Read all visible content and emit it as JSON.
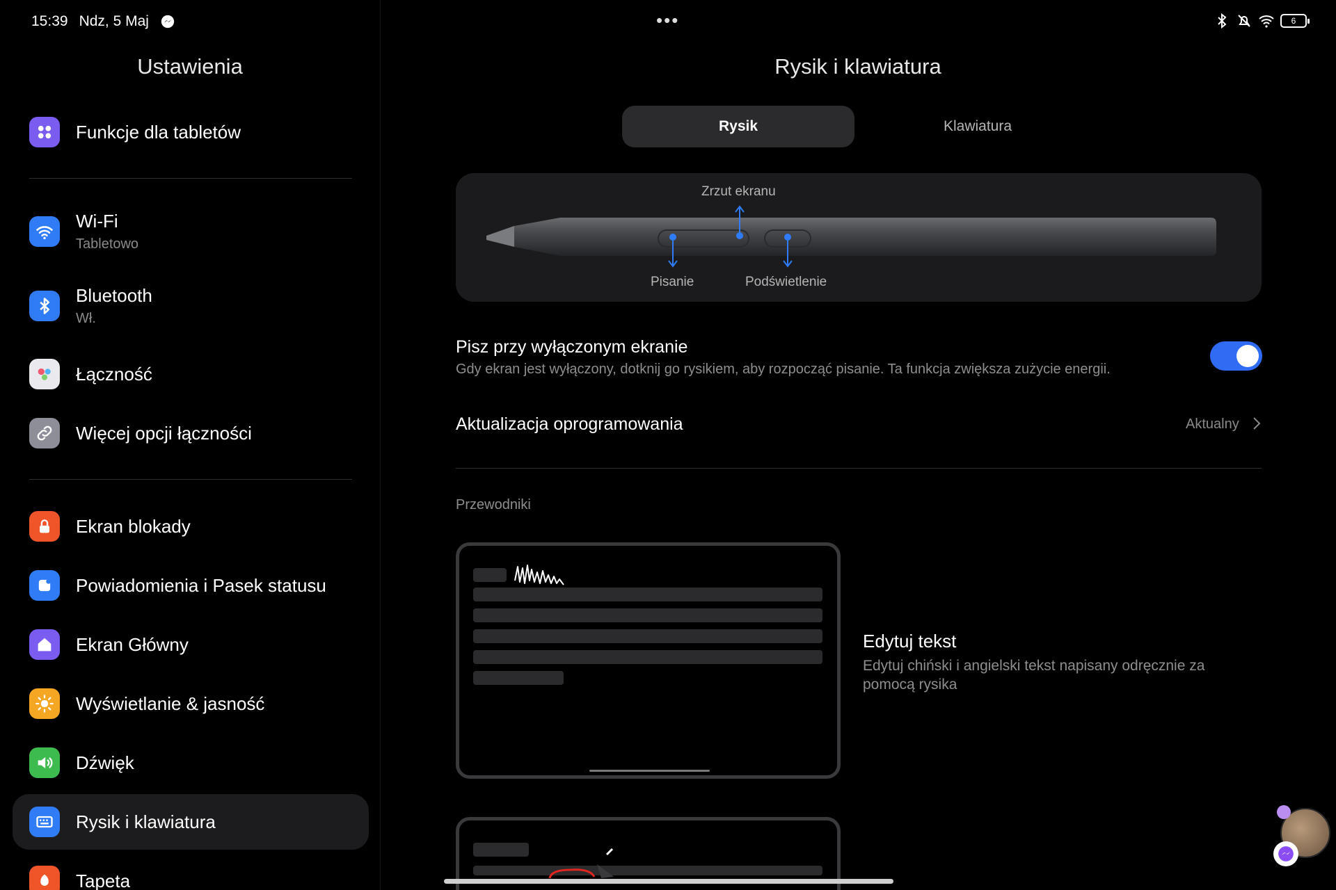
{
  "status_bar": {
    "time": "15:39",
    "date": "Ndz, 5 Maj",
    "dots": "•••",
    "battery": "6"
  },
  "sidebar": {
    "title": "Ustawienia",
    "items": [
      {
        "label": "Funkcje dla tabletów",
        "sub": "",
        "icon": "apps-grid-icon",
        "color": "#7b5cf0"
      },
      {
        "label": "Wi-Fi",
        "sub": "Tabletowo",
        "icon": "wifi-icon",
        "color": "#2f7cf6"
      },
      {
        "label": "Bluetooth",
        "sub": "Wł.",
        "icon": "bluetooth-icon",
        "color": "#2f7cf6"
      },
      {
        "label": "Łączność",
        "sub": "",
        "icon": "connectivity-icon",
        "color": "#e9e9ee"
      },
      {
        "label": "Więcej opcji łączności",
        "sub": "",
        "icon": "link-icon",
        "color": "#8e8e99"
      },
      {
        "label": "Ekran blokady",
        "sub": "",
        "icon": "lock-icon",
        "color": "#f0552a"
      },
      {
        "label": "Powiadomienia i Pasek statusu",
        "sub": "",
        "icon": "notification-icon",
        "color": "#2f7cf6"
      },
      {
        "label": "Ekran Główny",
        "sub": "",
        "icon": "home-icon",
        "color": "#7b5cf0"
      },
      {
        "label": "Wyświetlanie & jasność",
        "sub": "",
        "icon": "sun-icon",
        "color": "#f5a623"
      },
      {
        "label": "Dźwięk",
        "sub": "",
        "icon": "speaker-icon",
        "color": "#3dbb4f"
      },
      {
        "label": "Rysik i klawiatura",
        "sub": "",
        "icon": "keyboard-icon",
        "color": "#2f7cf6"
      },
      {
        "label": "Tapeta",
        "sub": "",
        "icon": "wallpaper-icon",
        "color": "#f0552a"
      }
    ]
  },
  "main": {
    "title": "Rysik i klawiatura",
    "tabs": [
      {
        "label": "Rysik",
        "active": true
      },
      {
        "label": "Klawiatura",
        "active": false
      }
    ],
    "pen_diagram": {
      "top_label": "Zrzut ekranu",
      "bottom_left_label": "Pisanie",
      "bottom_right_label": "Podświetlenie"
    },
    "write_screen_off": {
      "title": "Pisz przy wyłączonym ekranie",
      "description": "Gdy ekran jest wyłączony, dotknij go rysikiem, aby rozpocząć pisanie. Ta funkcja zwiększa zużycie energii.",
      "enabled": true
    },
    "firmware": {
      "title": "Aktualizacja oprogramowania",
      "value": "Aktualny"
    },
    "guides": {
      "header": "Przewodniki",
      "items": [
        {
          "title": "Edytuj tekst",
          "description": "Edytuj chiński i angielski tekst napisany odręcznie za pomocą rysika"
        }
      ]
    }
  }
}
